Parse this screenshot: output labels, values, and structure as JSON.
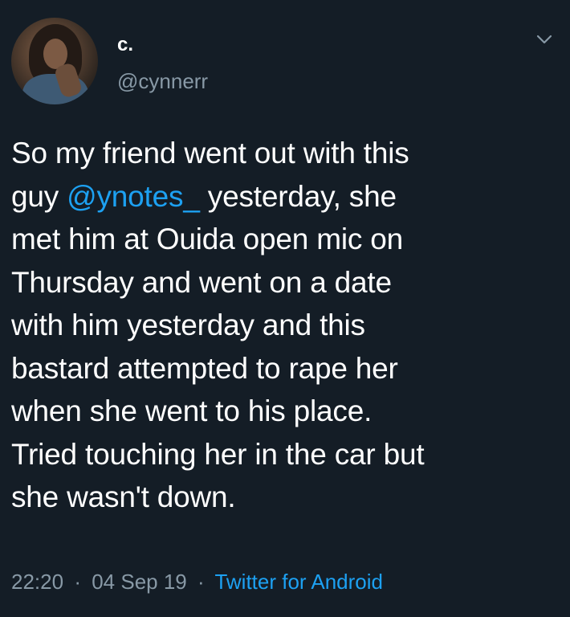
{
  "author": {
    "display_name": "c.",
    "username": "@cynnerr"
  },
  "tweet": {
    "lines": [
      {
        "segments": [
          {
            "text": "So my friend went out with this",
            "type": "text"
          }
        ]
      },
      {
        "segments": [
          {
            "text": "guy ",
            "type": "text"
          },
          {
            "text": "@ynotes_",
            "type": "mention"
          },
          {
            "text": " yesterday, she",
            "type": "text"
          }
        ]
      },
      {
        "segments": [
          {
            "text": "met him at Ouida open mic on",
            "type": "text"
          }
        ]
      },
      {
        "segments": [
          {
            "text": "Thursday and went on a date",
            "type": "text"
          }
        ]
      },
      {
        "segments": [
          {
            "text": "with him yesterday and this",
            "type": "text"
          }
        ]
      },
      {
        "segments": [
          {
            "text": "bastard attempted to rape her",
            "type": "text"
          }
        ]
      },
      {
        "segments": [
          {
            "text": "when she went to his place.",
            "type": "text"
          }
        ]
      },
      {
        "segments": [
          {
            "text": "Tried touching her in the car but",
            "type": "text"
          }
        ]
      },
      {
        "segments": [
          {
            "text": "she wasn't down.",
            "type": "text"
          }
        ]
      }
    ]
  },
  "meta": {
    "time": "22:20",
    "separator": "·",
    "date": "04 Sep 19",
    "source": "Twitter for Android"
  },
  "colors": {
    "background": "#141d26",
    "text": "#ffffff",
    "secondary": "#8899a6",
    "link": "#1da1f2"
  },
  "icons": {
    "menu": "chevron-down-icon",
    "avatar": "profile-photo"
  }
}
